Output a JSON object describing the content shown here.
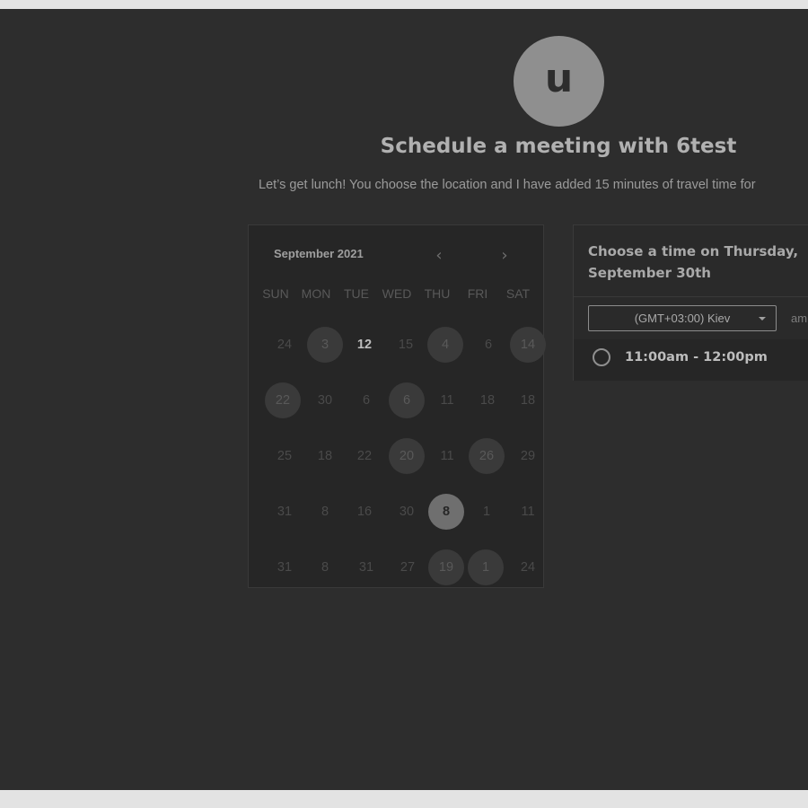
{
  "header": {
    "avatar_letter": "u",
    "title": "Schedule a meeting with 6test",
    "subtitle": "Let’s get lunch! You choose the location and I have added 15 minutes of travel time for"
  },
  "calendar": {
    "month_label": "September 2021",
    "prev_icon": "‹",
    "next_icon": "›",
    "weekdays": [
      "SUN",
      "MON",
      "TUE",
      "WED",
      "THU",
      "FRI",
      "SAT"
    ],
    "weeks": [
      [
        "24",
        "3",
        "12",
        "15",
        "4",
        "6",
        "14"
      ],
      [
        "22",
        "30",
        "6",
        "6",
        "11",
        "18",
        "18"
      ],
      [
        "25",
        "18",
        "22",
        "20",
        "11",
        "26",
        "29"
      ],
      [
        "31",
        "8",
        "16",
        "30",
        "8",
        "1",
        "11"
      ],
      [
        "31",
        "8",
        "31",
        "27",
        "19",
        "1",
        "24"
      ]
    ],
    "selected_day": "8"
  },
  "time_panel": {
    "heading": "Choose a time on Thursday, September 30th",
    "timezone": "(GMT+03:00) Kiev",
    "format_toggle": "am",
    "slots": [
      "11:00am - 12:00pm"
    ]
  },
  "colors": {
    "page_background": "#2d2d2d",
    "outer_frame": "#e3e3e3",
    "avatar": "#8f8f8f"
  }
}
